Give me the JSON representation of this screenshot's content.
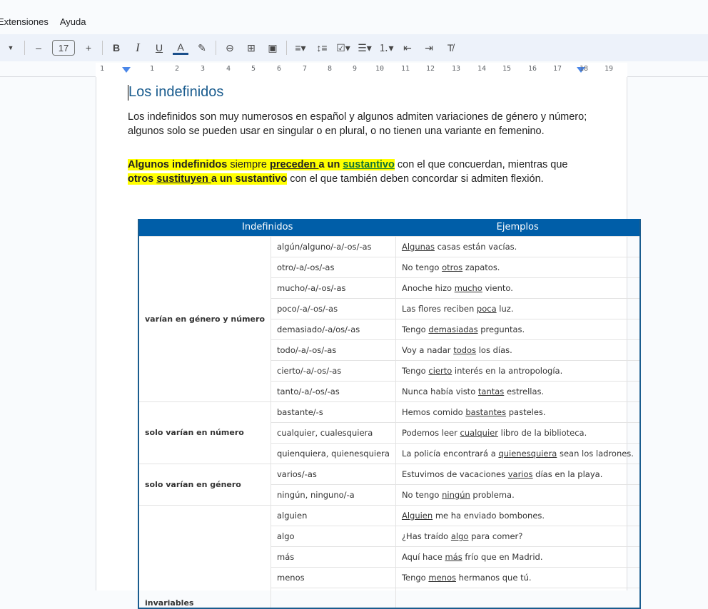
{
  "menu": [
    "Extensiones",
    "Ayuda"
  ],
  "toolbar": {
    "font_size": "17",
    "minus": "–",
    "plus": "+",
    "bold": "B",
    "italic": "I",
    "underline": "U",
    "text_color": "A"
  },
  "ruler": [
    "1",
    "1",
    "2",
    "3",
    "4",
    "5",
    "6",
    "7",
    "8",
    "9",
    "10",
    "11",
    "12",
    "13",
    "14",
    "15",
    "16",
    "17",
    "18",
    "19"
  ],
  "doc": {
    "title": "Los indefinidos",
    "p1": "Los indefinidos son muy numerosos en español y algunos admiten variaciones de género y número; algunos solo se pueden usar en singular o en plural, o no tienen una variante en femenino.",
    "p2": {
      "a": "Algunos indefinidos",
      "b": " siempre ",
      "c": "preceden ",
      "d": "a un ",
      "e": "sustantivo",
      "f": " con el que concuerdan, mientras que ",
      "g": "otros ",
      "h": "sustituyen ",
      "i": "a un sustantivo",
      "j": " con el que también deben concordar si admiten flexión."
    }
  },
  "table": {
    "headers": [
      "Indefinidos",
      "Ejemplos"
    ],
    "groups": [
      {
        "label": "varían en género y número",
        "rows": [
          {
            "form": "algún/alguno/-a/-os/-as",
            "pre": "",
            "w": "Algunas",
            "post": " casas están vacías."
          },
          {
            "form": "otro/-a/-os/-as",
            "pre": "No tengo ",
            "w": "otros",
            "post": " zapatos."
          },
          {
            "form": "mucho/-a/-os/-as",
            "pre": "Anoche hizo ",
            "w": "mucho",
            "post": " viento."
          },
          {
            "form": "poco/-a/-os/-as",
            "pre": "Las flores reciben ",
            "w": "poca",
            "post": " luz."
          },
          {
            "form": "demasiado/-a/os/-as",
            "pre": "Tengo ",
            "w": "demasiadas",
            "post": " preguntas."
          },
          {
            "form": "todo/-a/-os/-as",
            "pre": "Voy a nadar ",
            "w": "todos",
            "post": " los días."
          },
          {
            "form": "cierto/-a/-os/-as",
            "pre": "Tengo ",
            "w": "cierto",
            "post": " interés en la antropología."
          },
          {
            "form": "tanto/-a/-os/-as",
            "pre": "Nunca había visto ",
            "w": "tantas",
            "post": " estrellas."
          }
        ]
      },
      {
        "label": "solo varían en número",
        "rows": [
          {
            "form": "bastante/-s",
            "pre": "Hemos comido ",
            "w": "bastantes",
            "post": " pasteles."
          },
          {
            "form": "cualquier, cualesquiera",
            "pre": "Podemos leer ",
            "w": "cualquier",
            "post": " libro de la biblioteca."
          },
          {
            "form": "quienquiera, quienesquiera",
            "pre": "La policía encontrará a ",
            "w": "quienesquiera",
            "post": " sean los ladrones."
          }
        ]
      },
      {
        "label": "solo varían en género",
        "rows": [
          {
            "form": "varios/-as",
            "pre": "Estuvimos de vacaciones ",
            "w": "varios",
            "post": " días en la playa."
          },
          {
            "form": "ningún, ninguno/-a",
            "pre": "No tengo ",
            "w": "ningún",
            "post": " problema."
          }
        ]
      },
      {
        "label": "invariables",
        "rows": [
          {
            "form": "alguien",
            "pre": "",
            "w": "Alguien",
            "post": " me ha enviado bombones."
          },
          {
            "form": "algo",
            "pre": "¿Has traído ",
            "w": "algo",
            "post": " para comer?"
          },
          {
            "form": "más",
            "pre": "Aquí hace ",
            "w": "más",
            "post": " frío que en Madrid."
          },
          {
            "form": "menos",
            "pre": "Tengo ",
            "w": "menos",
            "post": " hermanos que tú."
          },
          {
            "form": "",
            "pre": "",
            "w": "",
            "post": ""
          }
        ]
      }
    ]
  }
}
